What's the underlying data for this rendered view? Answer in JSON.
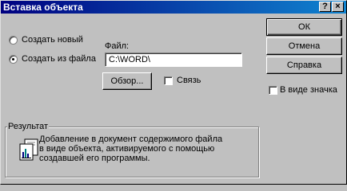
{
  "window": {
    "title": "Вставка объекта",
    "help_glyph": "?",
    "close_glyph": "×"
  },
  "options": {
    "create_new": "Создать новый",
    "create_from_file": "Создать из файла",
    "selected": "create_from_file"
  },
  "file": {
    "label": "Файл:",
    "value": "C:\\WORD\\"
  },
  "browse_label": "Обзор...",
  "link_label": "Связь",
  "link_checked": false,
  "buttons": {
    "ok": "ОК",
    "cancel": "Отмена",
    "help": "Справка"
  },
  "as_icon_label": "В виде значка",
  "as_icon_checked": false,
  "result": {
    "label": "Результат",
    "lines": [
      "Добавление в документ содержимого файла",
      "в виде объекта, активируемого с помощью",
      "создавшей его программы."
    ]
  },
  "colors": {
    "titlebar_start": "#000080",
    "titlebar_end": "#1084d0",
    "face": "#c0c0c0"
  }
}
